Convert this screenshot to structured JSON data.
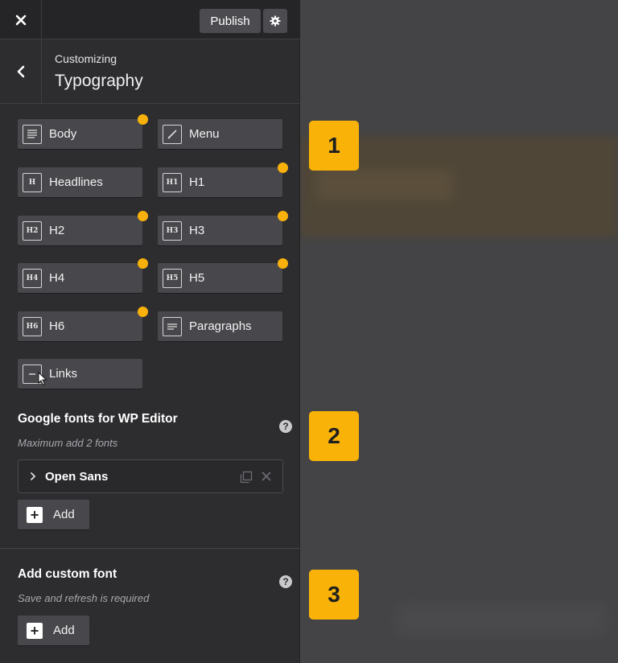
{
  "topbar": {
    "publish_label": "Publish"
  },
  "header": {
    "breadcrumb": "Customizing",
    "title": "Typography"
  },
  "typography_buttons": [
    {
      "label": "Body",
      "icon": "body-text-icon",
      "modified": true
    },
    {
      "label": "Menu",
      "icon": "pen-icon",
      "modified": false
    },
    {
      "label": "Headlines",
      "icon": "headline-icon",
      "icon_text": "H",
      "modified": false
    },
    {
      "label": "H1",
      "icon": "h1-icon",
      "icon_text": "H1",
      "modified": true
    },
    {
      "label": "H2",
      "icon": "h2-icon",
      "icon_text": "H2",
      "modified": true
    },
    {
      "label": "H3",
      "icon": "h3-icon",
      "icon_text": "H3",
      "modified": true
    },
    {
      "label": "H4",
      "icon": "h4-icon",
      "icon_text": "H4",
      "modified": true
    },
    {
      "label": "H5",
      "icon": "h5-icon",
      "icon_text": "H5",
      "modified": true
    },
    {
      "label": "H6",
      "icon": "h6-icon",
      "icon_text": "H6",
      "modified": true
    },
    {
      "label": "Paragraphs",
      "icon": "paragraph-icon",
      "modified": false
    },
    {
      "label": "Links",
      "icon": "link-icon",
      "modified": false
    }
  ],
  "google_fonts": {
    "title": "Google fonts for WP Editor",
    "subtitle": "Maximum add 2 fonts",
    "fonts": [
      "Open Sans"
    ],
    "add_label": "Add"
  },
  "custom_font": {
    "title": "Add custom font",
    "subtitle": "Save and refresh is required",
    "add_label": "Add"
  },
  "badges": [
    "1",
    "2",
    "3"
  ],
  "colors": {
    "accent": "#f9b208",
    "panel": "#2d2d30",
    "button": "#48484c"
  }
}
